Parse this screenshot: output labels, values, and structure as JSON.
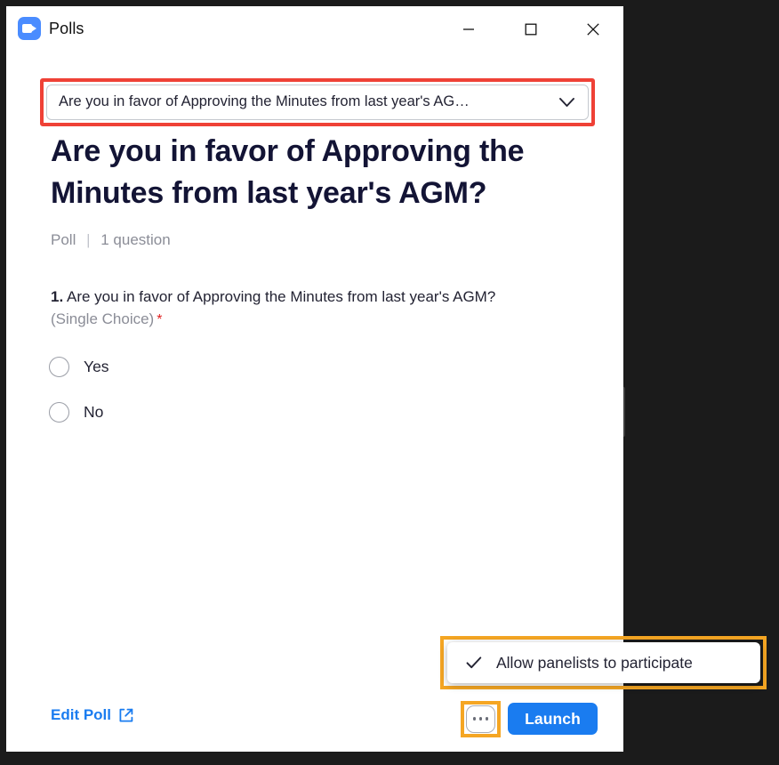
{
  "window": {
    "title": "Polls",
    "app_icon": "zoom-logo-icon",
    "controls": {
      "minimize": "minimize-icon",
      "maximize": "maximize-icon",
      "close": "close-icon"
    }
  },
  "poll_selector": {
    "selected_value": "Are you in favor of Approving the Minutes from last year's AG…",
    "caret_icon": "chevron-down-icon",
    "highlight_color": "#ef4136"
  },
  "poll": {
    "title": "Are you in favor of Approving the Minutes from last year's AGM?",
    "type_label": "Poll",
    "meta_divider": "|",
    "question_count_label": "1 question"
  },
  "question": {
    "number": "1.",
    "text": "Are you in favor of Approving the Minutes from last year's AGM?",
    "type_label": "(Single Choice)",
    "required_marker": "*",
    "options": [
      {
        "label": "Yes",
        "selected": false
      },
      {
        "label": "No",
        "selected": false
      }
    ]
  },
  "footer": {
    "edit_poll_label": "Edit Poll",
    "edit_poll_icon": "external-link-icon",
    "more_options_icon": "ellipsis-icon",
    "launch_label": "Launch",
    "launch_color": "#1a7cf0"
  },
  "popup_menu": {
    "check_icon": "check-icon",
    "item_label": "Allow panelists to participate",
    "checked": true,
    "highlight_color": "#f5a623"
  }
}
